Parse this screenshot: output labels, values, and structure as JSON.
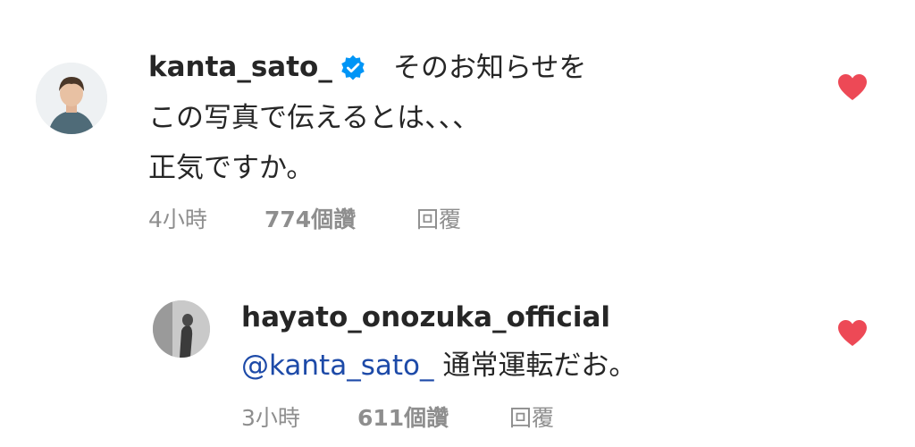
{
  "comments": [
    {
      "username": "kanta_sato_",
      "verified": true,
      "lines": [
        "そのお知らせを",
        "この写真で伝えるとは、、、",
        "正気ですか。"
      ],
      "time": "4小時",
      "likes": "774個讚",
      "reply": "回覆",
      "avatar_icon": "user-avatar",
      "liked": true
    },
    {
      "username": "hayato_onozuka_official",
      "verified": false,
      "mention": "@kanta_sato_",
      "text": "通常運転だお。",
      "time": "3小時",
      "likes": "611個讚",
      "reply": "回覆",
      "avatar_icon": "user-avatar",
      "has_story_ring": true,
      "liked": true
    }
  ],
  "colors": {
    "heart": "#ed4956",
    "verified": "#0095f6",
    "mention": "#1d4aa8",
    "meta": "#8e8e8e"
  }
}
